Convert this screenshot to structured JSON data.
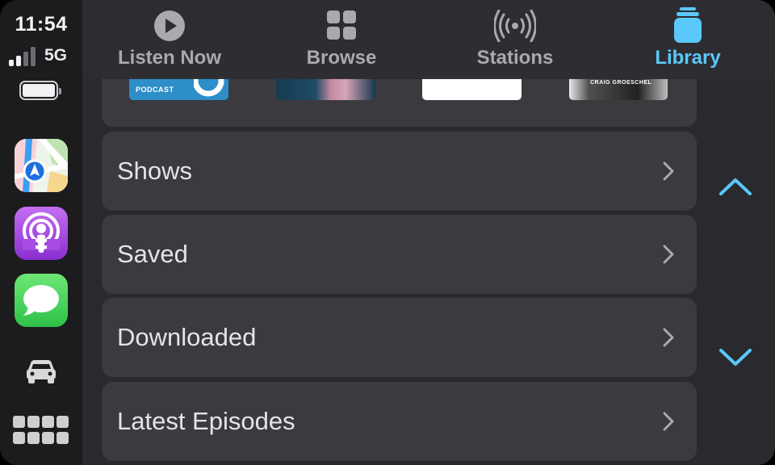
{
  "status": {
    "time": "11:54",
    "network": "5G",
    "signal_bars_filled": 2,
    "signal_bars_total": 4
  },
  "dock": {
    "apps": [
      {
        "name": "maps",
        "icon": "maps-app-icon"
      },
      {
        "name": "podcasts",
        "icon": "podcasts-app-icon"
      },
      {
        "name": "messages",
        "icon": "messages-app-icon"
      }
    ],
    "car_icon": "car-icon",
    "home_icon": "app-grid-icon"
  },
  "tabs": [
    {
      "label": "Listen Now",
      "icon": "play-circle-icon",
      "active": false
    },
    {
      "label": "Browse",
      "icon": "grid-icon",
      "active": false
    },
    {
      "label": "Stations",
      "icon": "broadcast-icon",
      "active": false
    },
    {
      "label": "Library",
      "icon": "library-stack-icon",
      "active": true
    }
  ],
  "artwork": [
    {
      "text": "PODCAST"
    },
    {
      "text": ""
    },
    {
      "text": ""
    },
    {
      "text": "CRAIG GROESCHEL"
    }
  ],
  "library_rows": [
    {
      "label": "Shows"
    },
    {
      "label": "Saved"
    },
    {
      "label": "Downloaded"
    },
    {
      "label": "Latest Episodes"
    }
  ],
  "colors": {
    "accent": "#5ac8fa",
    "inactive_tab": "#a9a9ae",
    "row_background": "#3a3a3f",
    "screen_background": "#2a2a2e",
    "dock_background": "#1c1c1e"
  },
  "scroll": {
    "up_icon": "chevron-up-icon",
    "down_icon": "chevron-down-icon"
  }
}
